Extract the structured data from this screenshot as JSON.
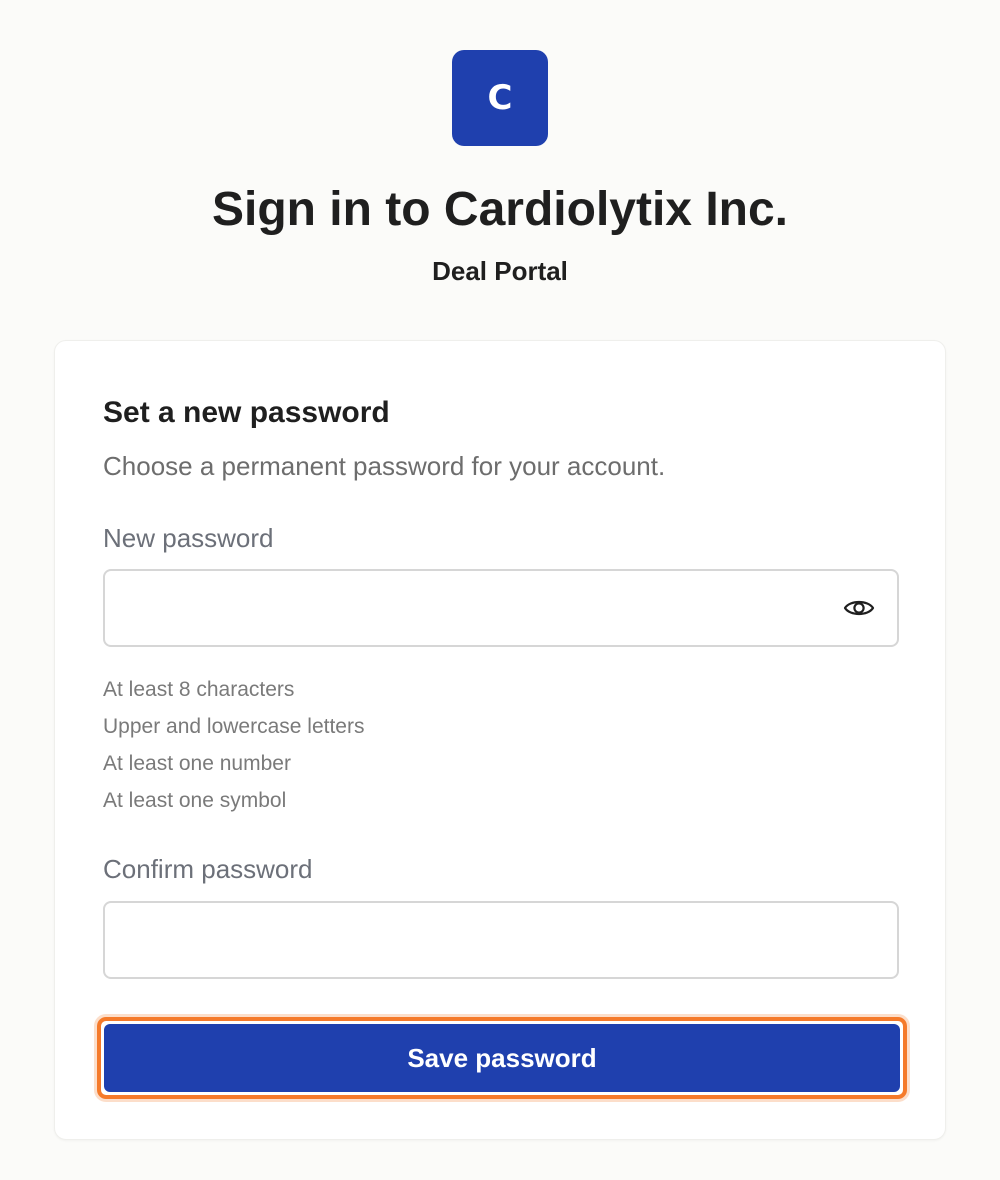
{
  "brand": {
    "logo_letter": "C",
    "accent_color": "#1f40ae"
  },
  "header": {
    "title": "Sign in to Cardiolytix Inc.",
    "subtitle": "Deal Portal"
  },
  "form": {
    "heading": "Set a new password",
    "description": "Choose a permanent password for your account.",
    "new_password": {
      "label": "New password",
      "value": "",
      "placeholder": "",
      "toggle_icon": "eye-icon"
    },
    "requirements": [
      "At least 8 characters",
      "Upper and lowercase letters",
      "At least one number",
      "At least one symbol"
    ],
    "confirm_password": {
      "label": "Confirm password",
      "value": "",
      "placeholder": ""
    },
    "submit_label": "Save password",
    "focus_ring_color": "#f57a2a"
  }
}
